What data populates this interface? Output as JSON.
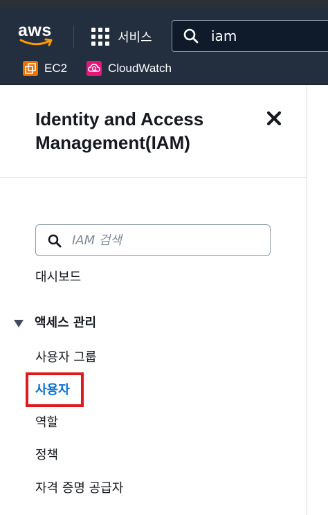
{
  "header": {
    "logo_text": "aws",
    "services_label": "서비스",
    "search_value": "iam",
    "favorites": [
      {
        "label": "EC2",
        "icon": "ec2-icon",
        "color": "#ed7100"
      },
      {
        "label": "CloudWatch",
        "icon": "cloudwatch-icon",
        "color": "#e7157b"
      }
    ]
  },
  "sidebar": {
    "title_line1": "Identity and Access",
    "title_line2": "Management(IAM)",
    "search_placeholder": "IAM 검색",
    "dashboard_label": "대시보드",
    "section_label": "액세스 관리",
    "items": [
      {
        "label": "사용자 그룹",
        "active": false
      },
      {
        "label": "사용자",
        "active": true
      },
      {
        "label": "역할",
        "active": false
      },
      {
        "label": "정책",
        "active": false
      },
      {
        "label": "자격 증명 공급자",
        "active": false
      }
    ]
  },
  "colors": {
    "header_bg": "#232f3e",
    "active_link": "#0972d3",
    "highlight": "#e0191b"
  }
}
